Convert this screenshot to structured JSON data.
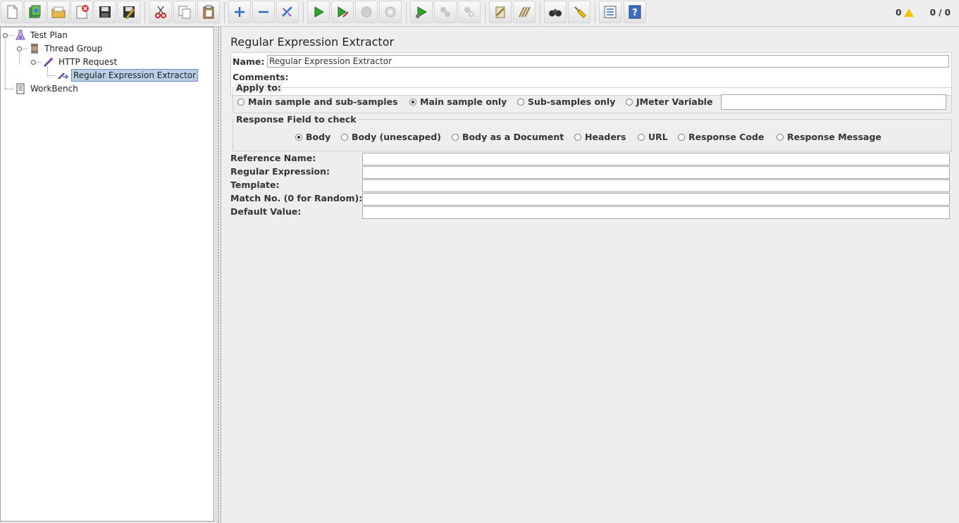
{
  "status": {
    "errors": "0",
    "threads": "0 / 0"
  },
  "tree": {
    "items": [
      {
        "label": "Test Plan",
        "icon": "test-plan-icon"
      },
      {
        "label": "Thread Group",
        "icon": "thread-group-icon"
      },
      {
        "label": "HTTP Request",
        "icon": "http-sampler-icon"
      },
      {
        "label": "Regular Expression Extractor",
        "icon": "regex-extractor-icon",
        "selected": true
      },
      {
        "label": "WorkBench",
        "icon": "workbench-icon"
      }
    ]
  },
  "editor": {
    "title": "Regular Expression Extractor",
    "name_label": "Name:",
    "name_value": "Regular Expression Extractor",
    "comments_label": "Comments:",
    "apply_to": {
      "title": "Apply to:",
      "options": [
        "Main sample and sub-samples",
        "Main sample only",
        "Sub-samples only",
        "JMeter Variable"
      ],
      "selected": "Main sample only",
      "variable_value": ""
    },
    "response_field": {
      "title": "Response Field to check",
      "options": [
        "Body",
        "Body (unescaped)",
        "Body as a Document",
        "Headers",
        "URL",
        "Response Code",
        "Response Message"
      ],
      "selected": "Body"
    },
    "fields": [
      {
        "label": "Reference Name:",
        "value": ""
      },
      {
        "label": "Regular Expression:",
        "value": ""
      },
      {
        "label": "Template:",
        "value": ""
      },
      {
        "label": "Match No. (0 for Random):",
        "value": ""
      },
      {
        "label": "Default Value:",
        "value": ""
      }
    ]
  }
}
